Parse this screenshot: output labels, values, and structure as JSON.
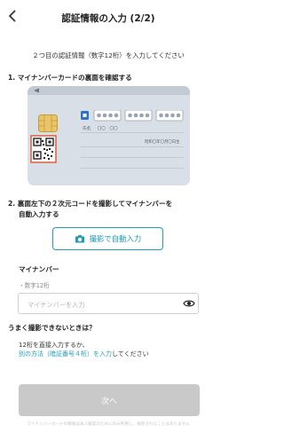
{
  "header": {
    "title": "認証情報の入力 (2/2)",
    "back_icon": "chevron-left-icon"
  },
  "intro": "２つ目の認証情報（数字12桁）を入力してください",
  "step1": {
    "title": "1. マイナンバーカードの裏面を確認する"
  },
  "card": {
    "name_label": "氏名",
    "name_value": "〇〇　〇〇",
    "birth_text": "昭和〇年〇月〇日生"
  },
  "step2": {
    "title_line1": "2. 裏面左下の２次元コードを撮影してマイナンバーを",
    "title_line2": "自動入力する",
    "button_label": "撮影で自動入力",
    "button_icon": "camera-icon"
  },
  "field": {
    "label": "マイナンバー",
    "hint": "・数字12桁",
    "placeholder": "マイナンバーを入力",
    "value": "",
    "visibility_icon": "eye-icon"
  },
  "help": {
    "title": "うまく撮影できないときは？",
    "line1": "12桁を直接入力するか、",
    "line2_link": "別の方法（暗証番号４桁）を入力",
    "line2_rest": "してください"
  },
  "next_button": {
    "label": "次へ",
    "enabled": false
  },
  "footer_note": "マイナンバーカードの情報は本人確認のためにのみ利用し、保存されることはありません",
  "colors": {
    "accent": "#1e9db5",
    "highlight": "#e0654b",
    "card": "#d9dfe6",
    "button_disabled": "#c9c9c9"
  }
}
